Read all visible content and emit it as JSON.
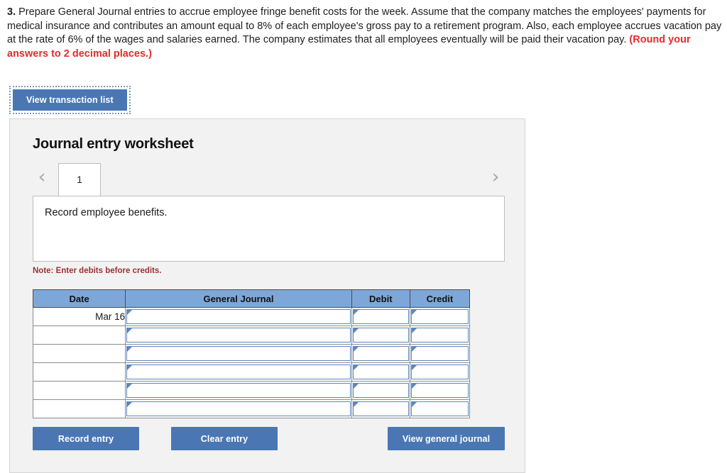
{
  "question": {
    "number": "3.",
    "body": "Prepare General Journal entries to accrue employee fringe benefit costs for the week. Assume that the company matches the employees' payments for medical insurance and contributes an amount equal to 8% of each employee's gross pay to a retirement program. Also, each employee accrues vacation pay at the rate of 6% of the wages and salaries earned. The company estimates that all employees eventually will be paid their vacation pay.",
    "emphasis": "(Round your answers to 2 decimal places.)"
  },
  "toolbar": {
    "view_transaction_list": "View transaction list"
  },
  "worksheet": {
    "title": "Journal entry worksheet",
    "prev_icon": "‹",
    "next_icon": "›",
    "tabs": [
      {
        "label": "1",
        "active": true
      }
    ],
    "description": "Record employee benefits.",
    "note": "Note: Enter debits before credits."
  },
  "table": {
    "headers": [
      "Date",
      "General Journal",
      "Debit",
      "Credit"
    ],
    "rows": [
      {
        "date": "Mar 16",
        "general_journal": "",
        "debit": "",
        "credit": ""
      },
      {
        "date": "",
        "general_journal": "",
        "debit": "",
        "credit": ""
      },
      {
        "date": "",
        "general_journal": "",
        "debit": "",
        "credit": ""
      },
      {
        "date": "",
        "general_journal": "",
        "debit": "",
        "credit": ""
      },
      {
        "date": "",
        "general_journal": "",
        "debit": "",
        "credit": ""
      },
      {
        "date": "",
        "general_journal": "",
        "debit": "",
        "credit": ""
      }
    ]
  },
  "footer": {
    "record_entry": "Record entry",
    "clear_entry": "Clear entry",
    "view_general_journal": "View general journal"
  },
  "colors": {
    "button_blue": "#4a77b4",
    "header_blue": "#7da7d9",
    "note_red": "#9b3232",
    "emphasis_red": "#e8292b",
    "panel_gray": "#f2f2f2",
    "input_border_blue": "#5b87bd"
  }
}
